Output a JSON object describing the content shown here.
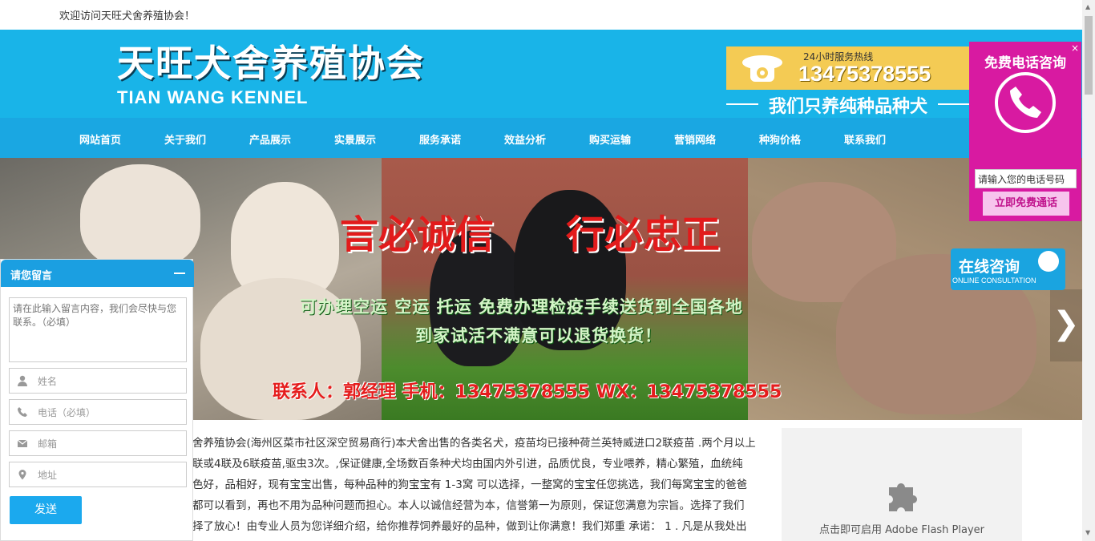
{
  "topbar": {
    "welcome": "欢迎访问天旺犬舍养殖协会！"
  },
  "header": {
    "logo_cn": "天旺犬舍养殖协会",
    "logo_en": "TIAN WANG KENNEL",
    "hotline_label": "24小时服务热线",
    "hotline_number": "13475378555",
    "slogan": "我们只养纯种品种犬",
    "accent_color": "#19b4e8"
  },
  "nav": {
    "items": [
      {
        "label": "网站首页"
      },
      {
        "label": "关于我们"
      },
      {
        "label": "产品展示"
      },
      {
        "label": "实景展示"
      },
      {
        "label": "服务承诺"
      },
      {
        "label": "效益分析"
      },
      {
        "label": "购买运输"
      },
      {
        "label": "营销网络"
      },
      {
        "label": "种狗价格"
      },
      {
        "label": "联系我们"
      }
    ]
  },
  "banner": {
    "title_left": "言必诚信",
    "title_right": "行必忠正",
    "line1": "可办理空运  空运  托运   免费办理检疫手续送货到全国各地",
    "line2": "到家试活不满意可以退货换货！",
    "contact": "联系人：郭经理  手机：13475378555  WX：13475378555"
  },
  "content": {
    "lines": [
      "舍养殖协会(海州区菜市社区深空贸易商行)本犬舍出售的各类名犬，疫苗均已接种荷兰英特威进口2联疫苗 .两个月以上",
      " 联或4联及6联疫苗,驱虫3次。,保证健康,全场数百条种犬均由国内外引进，品质优良，专业喂养，精心繁殖，血统纯",
      "色好，品相好，现有宝宝出售，每种品种的狗宝宝有 1-3窝 可以选择，一整窝的宝宝任您挑选，我们每窝宝宝的爸爸",
      "都可以看到，再也不用为品种问题而担心。本人以诚信经营为本，信誉第一为原则，保证您满意为宗旨。选择了我们",
      "择了放心！由专业人员为您详细介绍，给你推荐饲养最好的品种，做到让你满意！我们郑重 承诺： 1 . 凡是从我处出"
    ]
  },
  "flash": {
    "text": "点击即可启用 Adobe Flash Player"
  },
  "message_widget": {
    "title": "请您留言",
    "content_placeholder": "请在此输入留言内容，我们会尽快与您联系。（必填）",
    "name_placeholder": "姓名",
    "phone_placeholder": "电话（必填）",
    "email_placeholder": "邮箱",
    "address_placeholder": "地址",
    "send_label": "发送"
  },
  "callbox": {
    "title": "免费电话咨询",
    "close": "×",
    "input_value": "请输入您的电话号码",
    "button": "立即免费通话",
    "color": "#d81aa1"
  },
  "online": {
    "big": "在线咨询",
    "small": "ONLINE CONSULTATION"
  }
}
